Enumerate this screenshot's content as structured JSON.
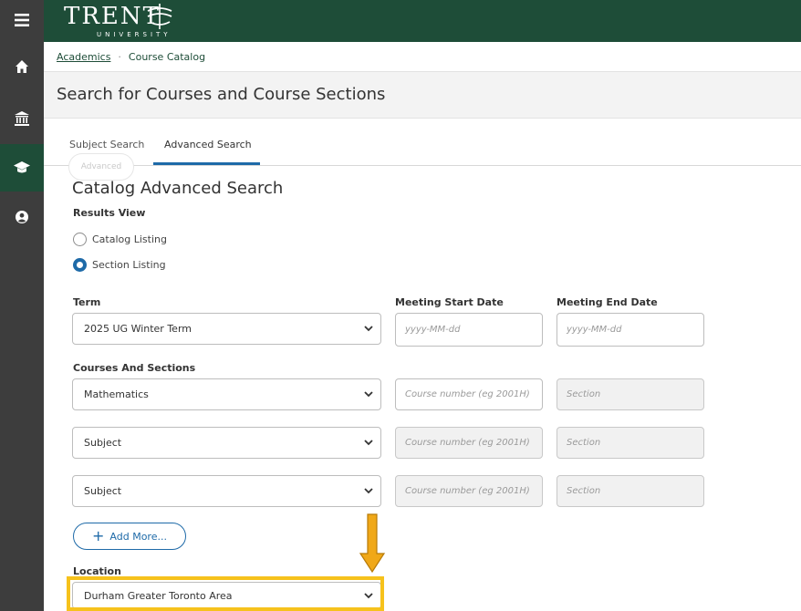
{
  "app": {
    "logo_main": "TRENT",
    "logo_sub": "UNIVERSITY"
  },
  "rail": {
    "items": [
      {
        "icon": "menu-icon"
      },
      {
        "icon": "home-icon"
      },
      {
        "icon": "institution-icon"
      },
      {
        "icon": "graduation-cap-icon",
        "active": true
      },
      {
        "icon": "user-circle-icon"
      }
    ]
  },
  "breadcrumb": {
    "items": [
      "Academics",
      "Course Catalog"
    ],
    "separator": "·"
  },
  "page": {
    "title": "Search for Courses and Course Sections"
  },
  "tabs": [
    {
      "label": "Subject Search",
      "active": false
    },
    {
      "label": "Advanced Search",
      "active": true
    }
  ],
  "ghost_button": "Advanced",
  "form": {
    "heading": "Catalog Advanced Search",
    "results_view_label": "Results View",
    "results_options": [
      {
        "label": "Catalog Listing",
        "selected": false
      },
      {
        "label": "Section Listing",
        "selected": true
      }
    ],
    "term_label": "Term",
    "term_value": "2025 UG Winter Term",
    "start_date_label": "Meeting Start Date",
    "start_date_placeholder": "yyyy-MM-dd",
    "end_date_label": "Meeting End Date",
    "end_date_placeholder": "yyyy-MM-dd",
    "courses_label": "Courses And Sections",
    "course_rows": [
      {
        "subject": "Mathematics",
        "course_placeholder": "Course number (eg 2001H)",
        "section_placeholder": "Section"
      },
      {
        "subject": "Subject",
        "course_placeholder": "Course number (eg 2001H)",
        "section_placeholder": "Section"
      },
      {
        "subject": "Subject",
        "course_placeholder": "Course number (eg 2001H)",
        "section_placeholder": "Section"
      }
    ],
    "add_more_label": "Add More...",
    "location_label": "Location",
    "location_value": "Durham Greater Toronto Area"
  },
  "colors": {
    "brand_green": "#1e4d38",
    "accent_blue": "#1e6aa8",
    "highlight_yellow": "#f6c21c",
    "arrow_orange": "#f0a818"
  }
}
